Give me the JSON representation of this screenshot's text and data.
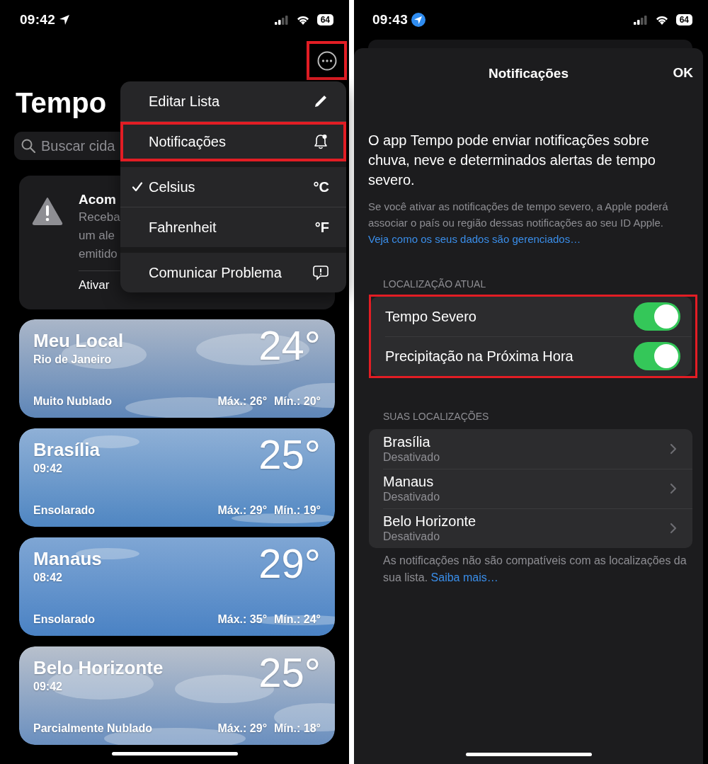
{
  "left_screen": {
    "status_bar": {
      "time": "09:42",
      "location_badge": false,
      "battery": "64"
    },
    "more_button": {
      "highlighted": true
    },
    "title": "Tempo",
    "search": {
      "placeholder": "Buscar cida"
    },
    "alert_card": {
      "title": "Acom",
      "lines": [
        "Receba",
        "um ale",
        "emitido"
      ],
      "action": "Ativar"
    },
    "menu": {
      "sections": [
        [
          {
            "label": "Editar Lista",
            "kind": "action",
            "checked": false,
            "highlighted": false
          },
          {
            "label": "Notificações",
            "kind": "action",
            "checked": false,
            "highlighted": true
          }
        ],
        [
          {
            "label": "Celsius",
            "kind": "unit",
            "symbol": "°C",
            "checked": true,
            "highlighted": false
          },
          {
            "label": "Fahrenheit",
            "kind": "unit",
            "symbol": "°F",
            "checked": false,
            "highlighted": false
          }
        ],
        [
          {
            "label": "Comunicar Problema",
            "kind": "action",
            "checked": false,
            "highlighted": false
          }
        ]
      ]
    },
    "locations": [
      {
        "name": "Meu Local",
        "subtitle": "Rio de Janeiro",
        "temperature": "24°",
        "condition": "Muito Nublado",
        "high": "Máx.: 26°",
        "low": "Mín.: 20°"
      },
      {
        "name": "Brasília",
        "subtitle": "09:42",
        "temperature": "25°",
        "condition": "Ensolarado",
        "high": "Máx.: 29°",
        "low": "Mín.: 19°"
      },
      {
        "name": "Manaus",
        "subtitle": "08:42",
        "temperature": "29°",
        "condition": "Ensolarado",
        "high": "Máx.: 35°",
        "low": "Mín.: 24°"
      },
      {
        "name": "Belo Horizonte",
        "subtitle": "09:42",
        "temperature": "25°",
        "condition": "Parcialmente Nublado",
        "high": "Máx.: 29°",
        "low": "Mín.: 18°"
      }
    ]
  },
  "right_screen": {
    "status_bar": {
      "time": "09:43",
      "location_badge": true,
      "battery": "64"
    },
    "sheet": {
      "title": "Notificações",
      "done": "OK",
      "intro": "O app Tempo pode enviar notificações sobre chuva, neve e determinados alertas de tempo severo.",
      "privacy": {
        "text": "Se você ativar as notificações de tempo severo, a Apple poderá associar o país ou região dessas notificações ao seu ID Apple.",
        "link": "Veja como os seus dados são gerenciados…"
      }
    },
    "current_location": {
      "header": "LOCALIZAÇÃO ATUAL",
      "highlighted": true,
      "toggles": [
        {
          "label": "Tempo Severo",
          "on": true
        },
        {
          "label": "Precipitação na Próxima Hora",
          "on": true
        }
      ]
    },
    "your_locations": {
      "header": "SUAS LOCALIZAÇÕES",
      "items": [
        {
          "name": "Brasília",
          "status": "Desativado"
        },
        {
          "name": "Manaus",
          "status": "Desativado"
        },
        {
          "name": "Belo Horizonte",
          "status": "Desativado"
        }
      ]
    },
    "footer": {
      "text": "As notificações não são compatíveis com as localizações da sua lista.",
      "link": "Saiba mais…"
    }
  }
}
